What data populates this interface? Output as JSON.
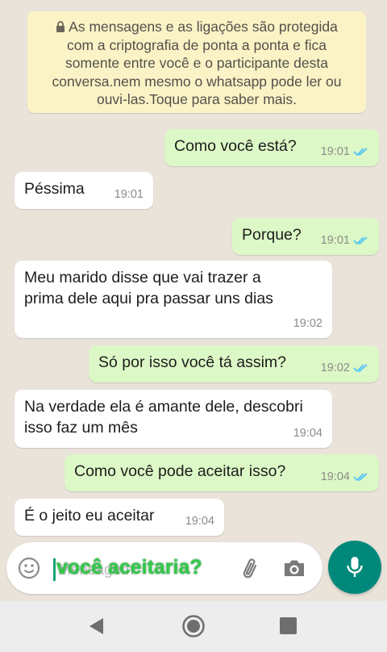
{
  "encryption_notice": "As mensagens e as ligações são protegida\ncom a criptografia de ponta a ponta e fica\nsomente entre você e o participante desta\nconversa.nem mesmo o whatsapp pode ler ou\nouvi-las.Toque para saber mais.",
  "messages": [
    {
      "text": "Como você está?",
      "time": "19:01",
      "direction": "outgoing",
      "status": "read"
    },
    {
      "text": "Péssima",
      "time": "19:01",
      "direction": "incoming"
    },
    {
      "text": "Porque?",
      "time": "19:01",
      "direction": "outgoing",
      "status": "read"
    },
    {
      "text": "Meu marido disse que vai trazer a\nprima dele aqui pra passar uns dias",
      "time": "19:02",
      "direction": "incoming"
    },
    {
      "text": "Só por isso você tá assim?",
      "time": "19:02",
      "direction": "outgoing",
      "status": "read"
    },
    {
      "text": "Na verdade ela é amante dele, descobri\nisso faz um mês",
      "time": "19:04",
      "direction": "incoming"
    },
    {
      "text": "Como você pode aceitar isso?",
      "time": "19:04",
      "direction": "outgoing",
      "status": "read"
    },
    {
      "text": "É o jeito eu aceitar",
      "time": "19:04",
      "direction": "incoming"
    }
  ],
  "composer": {
    "placeholder": "Mensagem",
    "overlay_caption": "você aceitaria?"
  },
  "colors": {
    "wallpaper": "#E9E3DA",
    "outgoing_bubble": "#DCF8C6",
    "incoming_bubble": "#FFFFFF",
    "notice_bg": "#FBF3C6",
    "read_ticks": "#4FC3F7",
    "mic_button": "#00897B",
    "caption": "#33c94a"
  },
  "icons": [
    "lock-icon",
    "double-check-icon",
    "emoji-icon",
    "paperclip-icon",
    "camera-icon",
    "mic-icon",
    "back-icon",
    "home-icon",
    "recents-icon"
  ]
}
